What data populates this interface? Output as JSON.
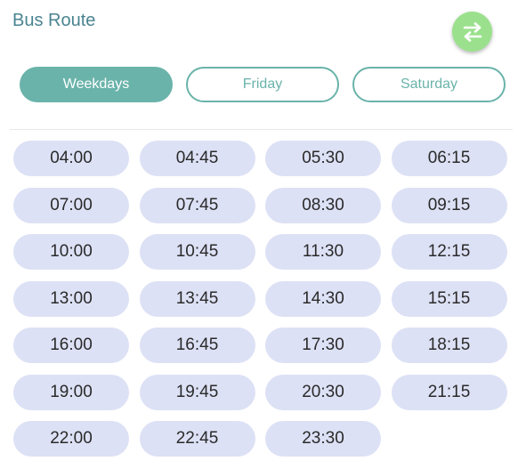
{
  "header": {
    "title": "Bus Route",
    "swap_icon": "swap-arrows-icon",
    "swap_color": "#9be18d"
  },
  "tabs": [
    {
      "label": "Weekdays",
      "active": true
    },
    {
      "label": "Friday",
      "active": false
    },
    {
      "label": "Saturday",
      "active": false
    }
  ],
  "colors": {
    "accent": "#6ab3aa",
    "time_chip": "#dde1f5",
    "title": "#4a8490"
  },
  "times": [
    "04:00",
    "04:45",
    "05:30",
    "06:15",
    "07:00",
    "07:45",
    "08:30",
    "09:15",
    "10:00",
    "10:45",
    "11:30",
    "12:15",
    "13:00",
    "13:45",
    "14:30",
    "15:15",
    "16:00",
    "16:45",
    "17:30",
    "18:15",
    "19:00",
    "19:45",
    "20:30",
    "21:15",
    "22:00",
    "22:45",
    "23:30"
  ]
}
